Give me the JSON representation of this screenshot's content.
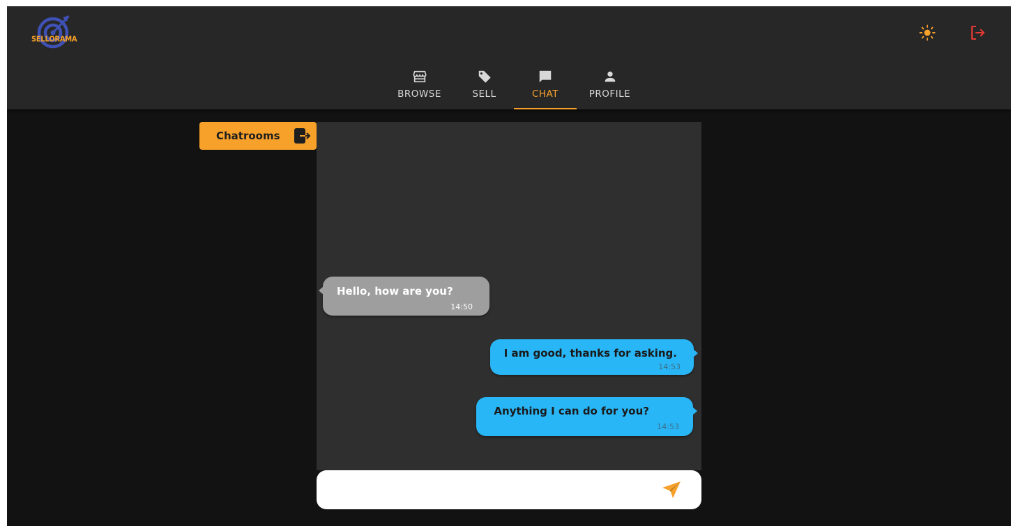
{
  "app": {
    "name": "SELLORAMA"
  },
  "header": {
    "logo_text": "SELLORAMA",
    "theme_toggle_icon": "sun-icon",
    "logout_icon": "logout-icon"
  },
  "nav": {
    "tabs": [
      {
        "label": "BROWSE",
        "icon": "storefront-icon",
        "active": false
      },
      {
        "label": "SELL",
        "icon": "tag-icon",
        "active": false
      },
      {
        "label": "CHAT",
        "icon": "chat-bubble-icon",
        "active": true
      },
      {
        "label": "PROFILE",
        "icon": "person-icon",
        "active": false
      }
    ]
  },
  "sidebar": {
    "chatrooms_label": "Chatrooms",
    "chatrooms_icon": "exit-arrow-icon"
  },
  "chat": {
    "messages": [
      {
        "direction": "incoming",
        "text": "Hello, how are you?",
        "time": "14:50"
      },
      {
        "direction": "outgoing",
        "text": "I am good, thanks for asking.",
        "time": "14:53"
      },
      {
        "direction": "outgoing",
        "text": "Anything I can do for you?",
        "time": "14:53"
      }
    ],
    "input": {
      "value": "",
      "placeholder": ""
    },
    "send_icon": "send-icon"
  },
  "colors": {
    "accent": "#f7a12a",
    "header_bg": "#272727",
    "page_bg": "#121212",
    "chat_panel_bg": "#2f2f2f",
    "incoming_bubble": "#9e9e9e",
    "outgoing_bubble": "#29b6f6",
    "logout_red": "#e53935",
    "logo_blue": "#3f51b5"
  }
}
